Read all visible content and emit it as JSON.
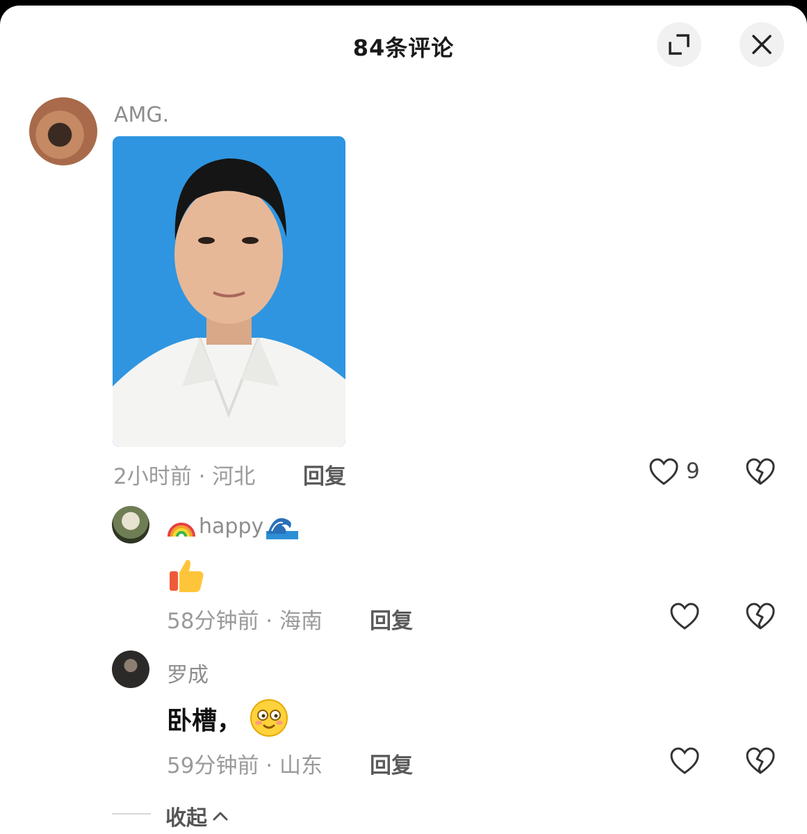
{
  "header": {
    "title": "84条评论",
    "expand_icon": "expand-icon",
    "close_icon": "close-icon"
  },
  "comments": [
    {
      "username": "AMG.",
      "time_location": "2小时前 · 河北",
      "reply_label": "回复",
      "likes": "9",
      "has_photo": true
    }
  ],
  "replies": [
    {
      "username": "happy",
      "username_prefix_icon": "rainbow-emoji",
      "username_suffix_icon": "wave-emoji",
      "content_icon": "thumbs-up-emoji",
      "time_location": "58分钟前 · 海南",
      "reply_label": "回复"
    },
    {
      "username": "罗成",
      "text": "卧槽，",
      "content_icon": "smiley-emoji",
      "time_location": "59分钟前 · 山东",
      "reply_label": "回复"
    }
  ],
  "collapse": {
    "label": "收起"
  }
}
